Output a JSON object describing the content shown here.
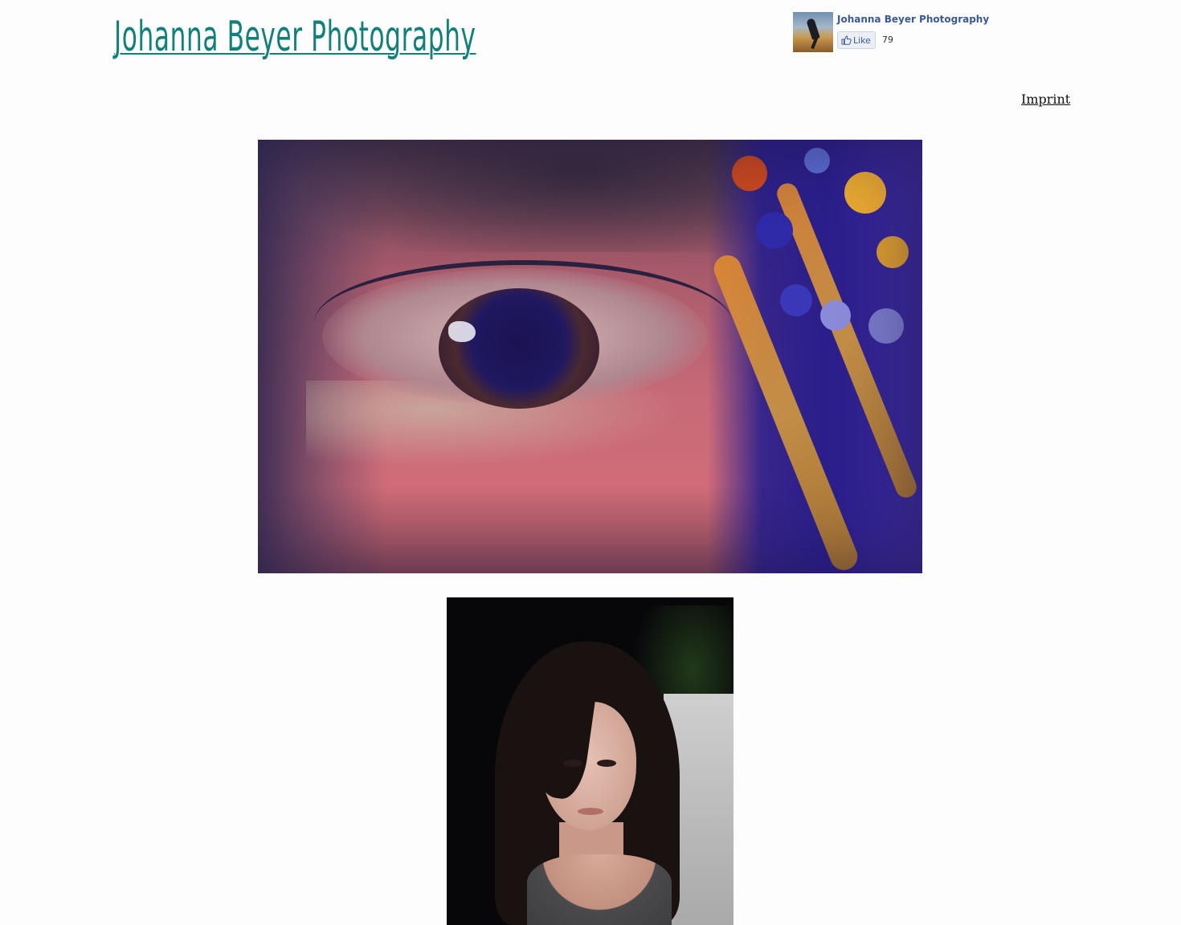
{
  "header": {
    "site_title": "Johanna Beyer Photography"
  },
  "facebook_widget": {
    "page_name": "Johanna Beyer Photography",
    "like_label": "Like",
    "like_count": "79",
    "colors": {
      "link": "#3b5998"
    },
    "icon": "thumbs-up-icon"
  },
  "nav": {
    "imprint_label": "Imprint"
  },
  "gallery": {
    "photos": [
      {
        "subject": "eye-closeup-photo"
      },
      {
        "subject": "portrait-photo"
      }
    ]
  },
  "colors": {
    "title": "#11807a",
    "background": "#fdfdfd"
  }
}
